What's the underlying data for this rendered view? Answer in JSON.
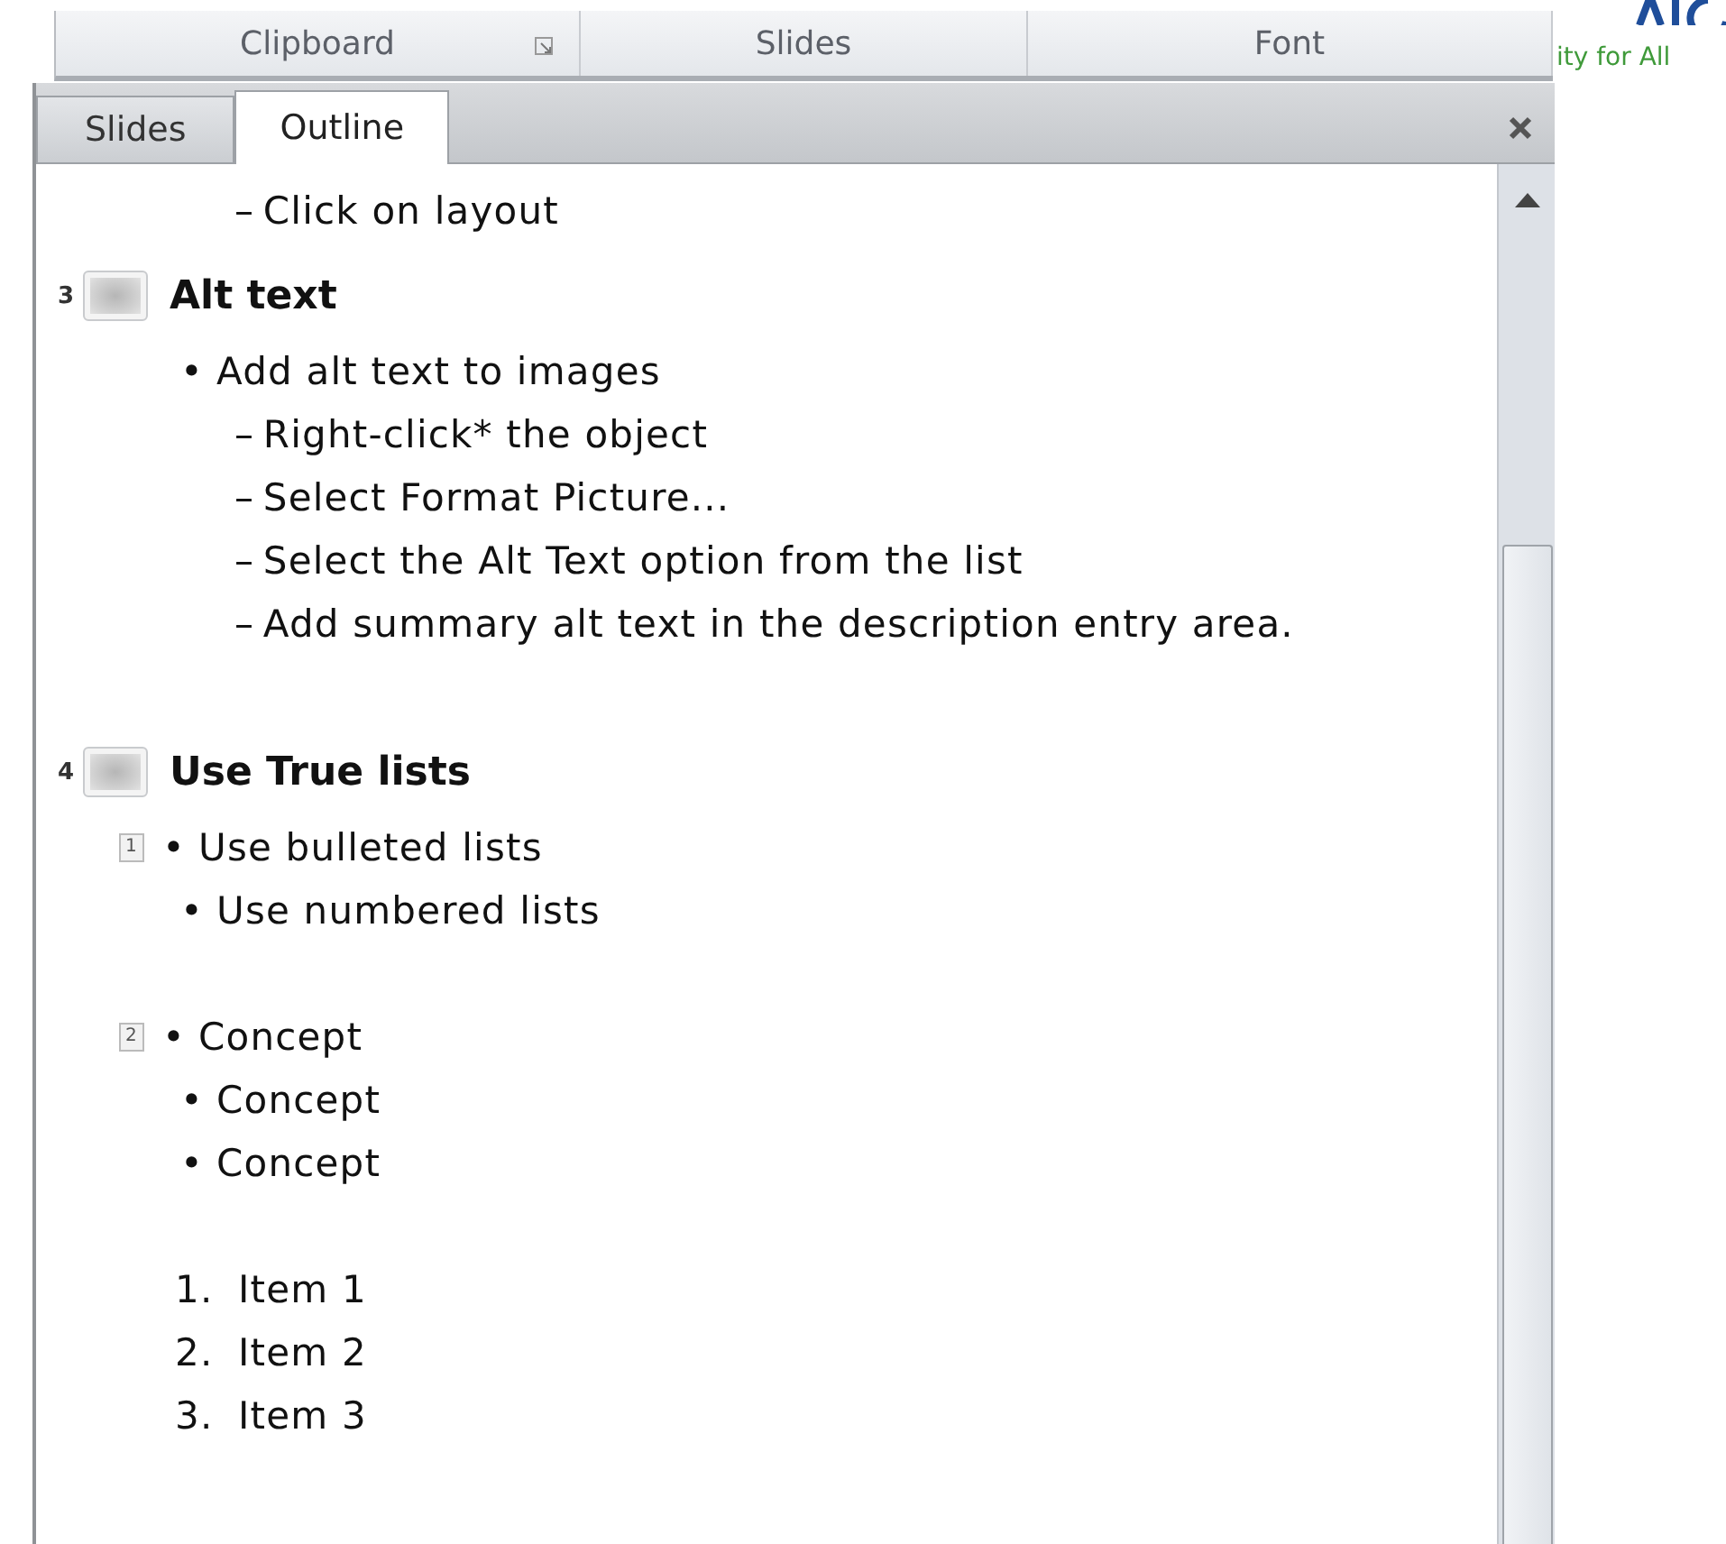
{
  "ribbon": {
    "groups": [
      {
        "label": "Clipboard",
        "launcher": true
      },
      {
        "label": "Slides",
        "launcher": false
      },
      {
        "label": "Font",
        "launcher": false
      }
    ]
  },
  "logo": {
    "tagline": "ity for All"
  },
  "pane": {
    "tabs": [
      {
        "label": "Slides",
        "selected": false
      },
      {
        "label": "Outline",
        "selected": true
      }
    ]
  },
  "outline": {
    "lines": [
      {
        "kind": "dash",
        "marker": "–",
        "text": "Click on layout"
      }
    ],
    "slides": [
      {
        "number": "3",
        "title": "Alt text",
        "lines": [
          {
            "kind": "bullet",
            "marker": "•",
            "text": "Add alt text to images"
          },
          {
            "kind": "dash",
            "marker": "–",
            "text": "Right-click* the object"
          },
          {
            "kind": "dash",
            "marker": "–",
            "text": "Select Format Picture..."
          },
          {
            "kind": "dash",
            "marker": "–",
            "text": "Select the Alt Text option from the list"
          },
          {
            "kind": "dash",
            "marker": "–",
            "text": "Add summary alt text in the description entry area."
          },
          {
            "kind": "blank"
          }
        ]
      },
      {
        "number": "4",
        "title": "Use True lists",
        "lines": [
          {
            "kind": "bullet",
            "marker": "•",
            "text": "Use bulleted lists",
            "placeholder": "1"
          },
          {
            "kind": "bullet",
            "marker": "•",
            "text": "Use numbered lists"
          },
          {
            "kind": "blank"
          },
          {
            "kind": "bullet",
            "marker": "•",
            "text": "Concept",
            "placeholder": "2"
          },
          {
            "kind": "bullet",
            "marker": "•",
            "text": "Concept"
          },
          {
            "kind": "bullet",
            "marker": "•",
            "text": "Concept"
          },
          {
            "kind": "blank"
          },
          {
            "kind": "numbered",
            "marker": "1.",
            "text": "Item 1"
          },
          {
            "kind": "numbered",
            "marker": "2.",
            "text": "Item 2"
          },
          {
            "kind": "numbered",
            "marker": "3.",
            "text": "Item 3"
          }
        ]
      }
    ]
  }
}
